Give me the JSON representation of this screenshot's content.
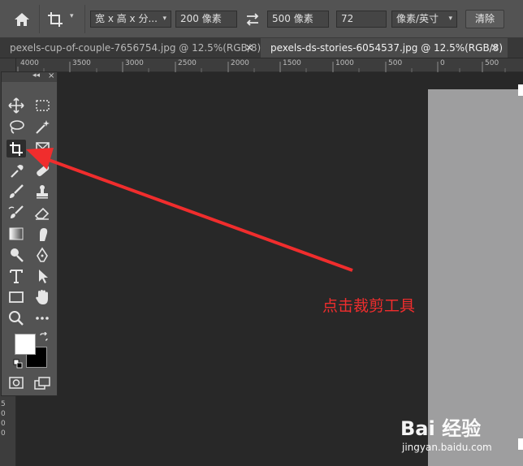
{
  "options_bar": {
    "ratio_preset": "宽 x 高 x 分...",
    "width_value": "200 像素",
    "height_value": "500 像素",
    "resolution_value": "72",
    "resolution_unit": "像素/英寸",
    "clear_label": "清除"
  },
  "tabs": [
    {
      "label": "pexels-cup-of-couple-7656754.jpg @ 12.5%(RGB/8)",
      "active": false
    },
    {
      "label": "pexels-ds-stories-6054537.jpg @ 12.5%(RGB/8)",
      "active": true
    }
  ],
  "ruler": {
    "h_labels": [
      "4000",
      "3500",
      "3000",
      "2500",
      "2000",
      "1500",
      "1000",
      "500",
      "0",
      "500"
    ],
    "v_labels": [
      "5",
      "0",
      "0",
      "0"
    ]
  },
  "toolbar": {
    "collapse_label": "◂◂",
    "close_label": "×",
    "selected_tool": "crop-tool"
  },
  "annotation": {
    "text": "点击裁剪工具",
    "color": "#f02d2d"
  },
  "watermark": {
    "line1": "Bai 经验",
    "line2": "jingyan.baidu.com"
  },
  "colors": {
    "foreground": "#ffffff",
    "background": "#000000"
  }
}
